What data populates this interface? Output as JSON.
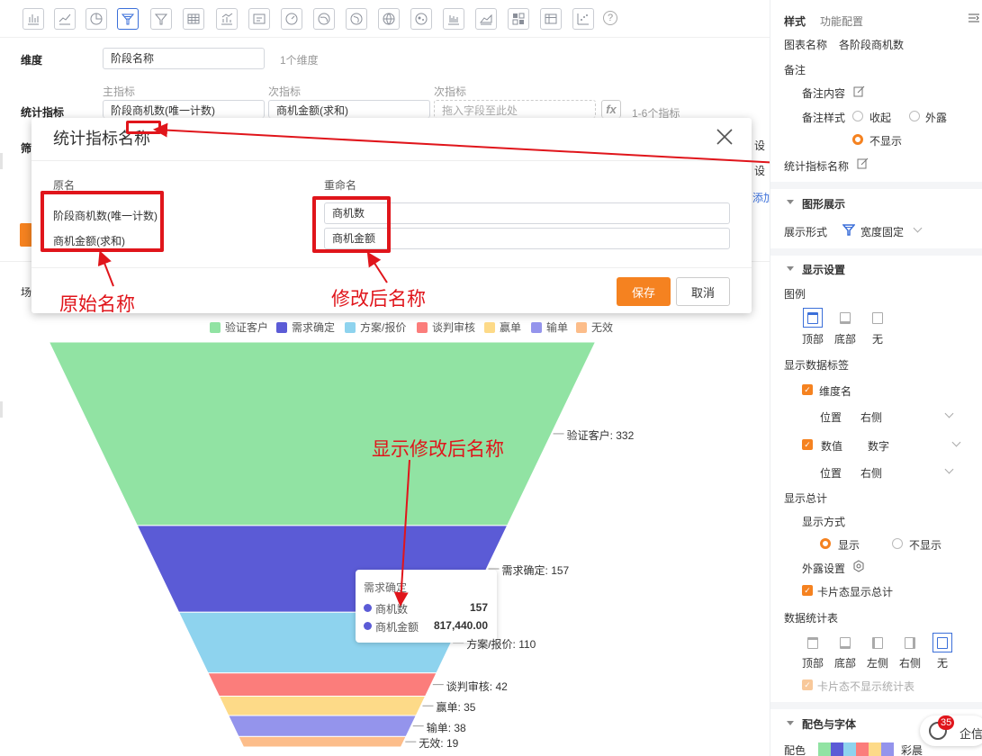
{
  "config": {
    "dimension_label": "维度",
    "dimension_value": "阶段名称",
    "dimension_hint": "1个维度",
    "metric_label": "统计指标",
    "primary_label": "主指标",
    "secondary_label": "次指标",
    "secondary_label2": "次指标",
    "primary_value": "阶段商机数(唯一计数)",
    "secondary_value": "商机金额(求和)",
    "drop_placeholder": "拖入字段至此处",
    "fx": "fx",
    "metric_hint": "1-6个指标",
    "filter_stub": "筛",
    "scene_stub": "场",
    "settings_stub1": "设",
    "settings_stub2": "设",
    "add_stub": "添加"
  },
  "modal": {
    "title": "统计指标名称",
    "col_original": "原名",
    "col_rename": "重命名",
    "rows": [
      {
        "original": "阶段商机数(唯一计数)",
        "rename": "商机数"
      },
      {
        "original": "商机金额(求和)",
        "rename": "商机金额"
      }
    ],
    "save": "保存",
    "cancel": "取消"
  },
  "annotations": {
    "original_name": "原始名称",
    "renamed": "修改后名称",
    "show_renamed": "显示修改后名称"
  },
  "legend": [
    {
      "name": "验证客户",
      "color": "#91e3a3"
    },
    {
      "name": "需求确定",
      "color": "#5b5bd6"
    },
    {
      "name": "方案/报价",
      "color": "#8ed3ee"
    },
    {
      "name": "谈判审核",
      "color": "#fb7d7b"
    },
    {
      "name": "赢单",
      "color": "#fdda88"
    },
    {
      "name": "输单",
      "color": "#9494ec"
    },
    {
      "name": "无效",
      "color": "#fcbd8a"
    }
  ],
  "chart_data": {
    "type": "funnel",
    "categories": [
      "验证客户",
      "需求确定",
      "方案/报价",
      "谈判审核",
      "赢单",
      "输单",
      "无效"
    ],
    "values": [
      332,
      157,
      110,
      42,
      35,
      38,
      19
    ],
    "labels": [
      "验证客户: 332",
      "需求确定: 157",
      "方案/报价: 110",
      "谈判审核: 42",
      "赢单: 35",
      "输单: 38",
      "无效: 19"
    ],
    "label_position": "right"
  },
  "tooltip": {
    "title": "需求确定",
    "rows": [
      {
        "name": "商机数",
        "value": "157"
      },
      {
        "name": "商机金额",
        "value": "817,440.00"
      }
    ]
  },
  "panel": {
    "tab_style": "样式",
    "tab_function": "功能配置",
    "chart_name_label": "图表名称",
    "chart_name_value": "各阶段商机数",
    "remark": "备注",
    "remark_content": "备注内容",
    "remark_style": "备注样式",
    "opt_collapse": "收起",
    "opt_expose": "外露",
    "opt_hide": "不显示",
    "metric_name": "统计指标名称",
    "graph_section": "图形展示",
    "display_form": "展示形式",
    "display_form_value": "宽度固定",
    "display_settings": "显示设置",
    "legend_label": "图例",
    "legend_top": "顶部",
    "legend_bottom": "底部",
    "legend_none": "无",
    "data_labels": "显示数据标签",
    "dim_name": "维度名",
    "position": "位置",
    "pos_right": "右侧",
    "value": "数值",
    "value_type": "数字",
    "position2": "位置",
    "pos_right2": "右侧",
    "show_total": "显示总计",
    "show_mode": "显示方式",
    "mode_show": "显示",
    "mode_hide": "不显示",
    "expose_settings": "外露设置",
    "card_total": "卡片态显示总计",
    "stat_table": "数据统计表",
    "st_top": "顶部",
    "st_bottom": "底部",
    "st_left": "左侧",
    "st_right": "右侧",
    "st_none": "无",
    "card_no_table": "卡片态不显示统计表",
    "color_font": "配色与字体",
    "palette_label": "配色",
    "palette_value": "彩晨",
    "palette_colors": [
      "#91e3a3",
      "#5b5bd6",
      "#8ed3ee",
      "#fb7d7b",
      "#fdda88",
      "#9494ec"
    ],
    "chat_badge": "35",
    "chat_label": "企信"
  }
}
